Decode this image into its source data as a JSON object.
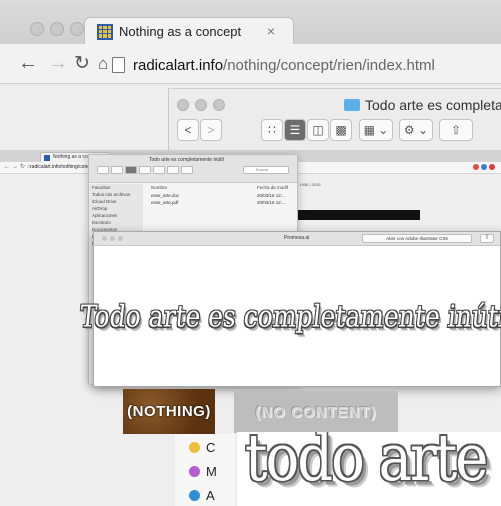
{
  "browser": {
    "tab_title": "Nothing as a concept",
    "tab_close": "×",
    "url_host": "radicalart.info",
    "url_path": "/nothing/concept/rien/index.html",
    "back_icon": "arrow-left",
    "forward_icon": "arrow-right",
    "reload_icon": "reload",
    "home_icon": "home"
  },
  "finder": {
    "title": "Todo arte es completan",
    "back": "<",
    "forward": ">"
  },
  "nested_browser": {
    "tab_title": "Nothing as a concept",
    "url": "radicalart.info/nothing/concept/rien/index.html",
    "side_text": "Alain Bellaiche | 1956 | 2016"
  },
  "nested_finder": {
    "title": "Todo arte es completamente inútil",
    "search_placeholder": "Buscar",
    "columns": [
      "Nombre",
      "Fecha de modif"
    ],
    "rows": [
      {
        "name": "esse_arte.doc",
        "date": "20/03/16 12:..."
      },
      {
        "name": "esse_arte.pdf",
        "date": "20/03/16 12:..."
      }
    ],
    "sidebar": [
      "Favoritos",
      "Todos mis archivos",
      "iCloud Drive",
      "AirDrop",
      "Aplicaciones",
      "Escritorio",
      "Documentos",
      "Descargas",
      "Etiquetas"
    ],
    "tag_colors": [
      "#f2a23a",
      "#e24a4a",
      "#f5d03b",
      "#5cc05c",
      "#4a90e2",
      "#b06ad6",
      "#9a9a9a"
    ]
  },
  "preview": {
    "title": "Promesa.ai",
    "open_button": "Abrir con Adobe Illustrator CS6",
    "share_icon": "share",
    "art_text": "Todo arte es completamente inútil"
  },
  "lower": {
    "nothing_label": "(NOTHING)",
    "nocontent_label": "(NO CONTENT)",
    "legend": [
      {
        "label": "C",
        "color": "#f0be3a"
      },
      {
        "label": "M",
        "color": "#b65bd4"
      },
      {
        "label": "A",
        "color": "#2f8fd8"
      }
    ],
    "big_text": "todo arte"
  }
}
